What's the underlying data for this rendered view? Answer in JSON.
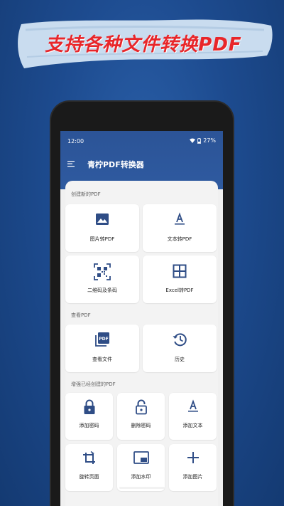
{
  "banner": {
    "text": "支持各种文件转换PDF"
  },
  "status": {
    "time": "12:00",
    "battery": "27%"
  },
  "app": {
    "title": "青柠PDF转换器"
  },
  "sections": {
    "create": {
      "title": "创建新的PDF",
      "items": [
        {
          "label": "图片转PDF",
          "icon": "image-icon"
        },
        {
          "label": "文本转PDF",
          "icon": "text-format-icon"
        },
        {
          "label": "二维码及条码",
          "icon": "qr-code-icon"
        },
        {
          "label": "Excel转PDF",
          "icon": "grid-icon"
        }
      ]
    },
    "view": {
      "title": "查看PDF",
      "items": [
        {
          "label": "查看文件",
          "icon": "pdf-file-icon"
        },
        {
          "label": "历史",
          "icon": "history-icon"
        }
      ]
    },
    "enhance": {
      "title": "增强已经创建的PDF",
      "items": [
        {
          "label": "添加密码",
          "icon": "lock-icon"
        },
        {
          "label": "删除密码",
          "icon": "unlock-icon"
        },
        {
          "label": "添加文本",
          "icon": "text-format-icon"
        },
        {
          "label": "旋转页面",
          "icon": "rotate-icon"
        },
        {
          "label": "添加水印",
          "icon": "watermark-icon"
        },
        {
          "label": "添加图片",
          "icon": "add-icon"
        }
      ]
    }
  },
  "colors": {
    "accent": "#2e5aa0",
    "icon": "#2f4d86",
    "banner_text": "#e8262a"
  }
}
